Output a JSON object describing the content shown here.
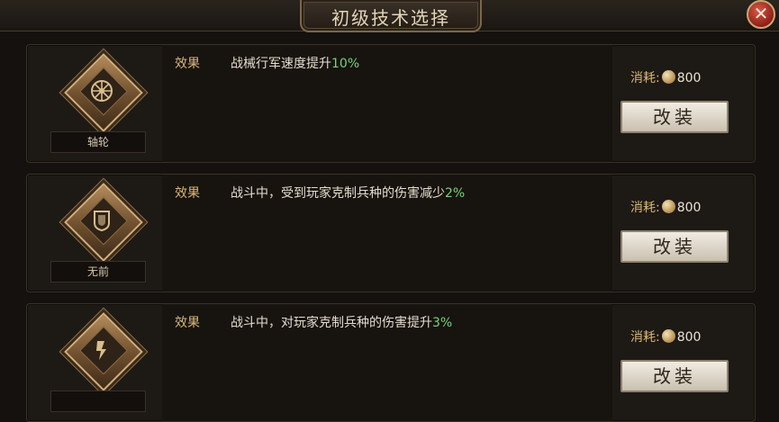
{
  "title": "初级技术选择",
  "close_symbol": "✕",
  "cards": [
    {
      "name": "轴轮",
      "icon": "wheel-icon",
      "effect_label": "效果",
      "effect_text": "战械行军速度提升",
      "effect_pct": "10%",
      "cost_label": "消耗:",
      "cost_value": "800",
      "button_label": "改装"
    },
    {
      "name": "无前",
      "icon": "shield-icon",
      "effect_label": "效果",
      "effect_text": "战斗中，受到玩家克制兵种的伤害减少",
      "effect_pct": "2%",
      "cost_label": "消耗:",
      "cost_value": "800",
      "button_label": "改装"
    },
    {
      "name": "",
      "icon": "blade-icon",
      "effect_label": "效果",
      "effect_text": "战斗中，对玩家克制兵种的伤害提升",
      "effect_pct": "3%",
      "cost_label": "消耗:",
      "cost_value": "800",
      "button_label": "改装"
    }
  ]
}
